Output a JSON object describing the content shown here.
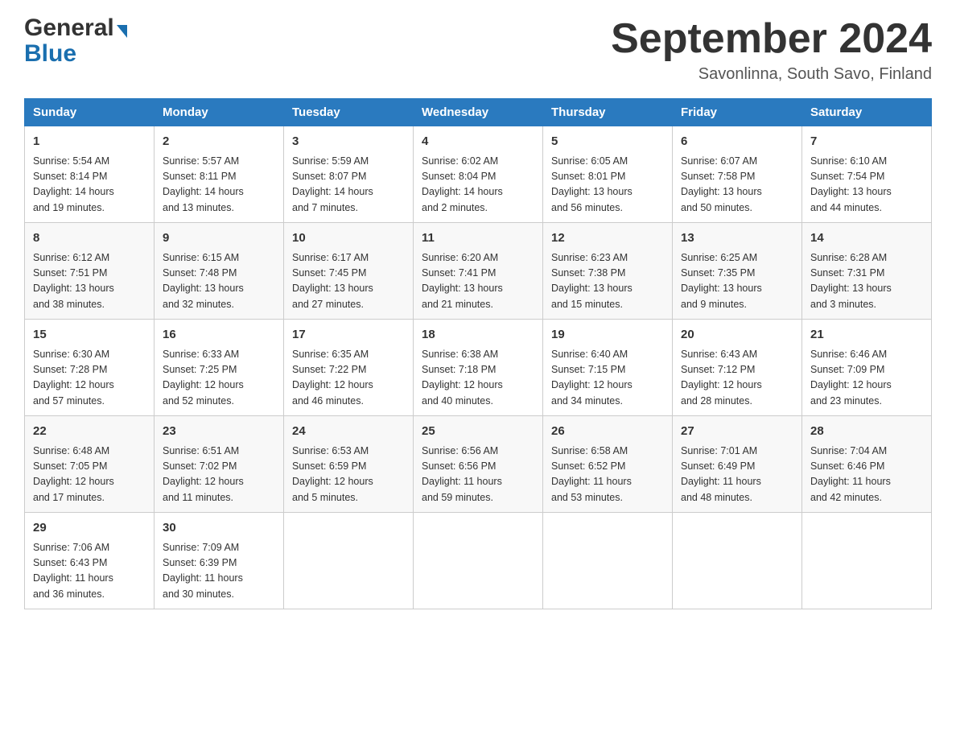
{
  "header": {
    "logo_general": "General",
    "logo_blue": "Blue",
    "title": "September 2024",
    "subtitle": "Savonlinna, South Savo, Finland"
  },
  "days_of_week": [
    "Sunday",
    "Monday",
    "Tuesday",
    "Wednesday",
    "Thursday",
    "Friday",
    "Saturday"
  ],
  "weeks": [
    [
      {
        "day": "1",
        "sunrise": "5:54 AM",
        "sunset": "8:14 PM",
        "daylight": "14 hours and 19 minutes."
      },
      {
        "day": "2",
        "sunrise": "5:57 AM",
        "sunset": "8:11 PM",
        "daylight": "14 hours and 13 minutes."
      },
      {
        "day": "3",
        "sunrise": "5:59 AM",
        "sunset": "8:07 PM",
        "daylight": "14 hours and 7 minutes."
      },
      {
        "day": "4",
        "sunrise": "6:02 AM",
        "sunset": "8:04 PM",
        "daylight": "14 hours and 2 minutes."
      },
      {
        "day": "5",
        "sunrise": "6:05 AM",
        "sunset": "8:01 PM",
        "daylight": "13 hours and 56 minutes."
      },
      {
        "day": "6",
        "sunrise": "6:07 AM",
        "sunset": "7:58 PM",
        "daylight": "13 hours and 50 minutes."
      },
      {
        "day": "7",
        "sunrise": "6:10 AM",
        "sunset": "7:54 PM",
        "daylight": "13 hours and 44 minutes."
      }
    ],
    [
      {
        "day": "8",
        "sunrise": "6:12 AM",
        "sunset": "7:51 PM",
        "daylight": "13 hours and 38 minutes."
      },
      {
        "day": "9",
        "sunrise": "6:15 AM",
        "sunset": "7:48 PM",
        "daylight": "13 hours and 32 minutes."
      },
      {
        "day": "10",
        "sunrise": "6:17 AM",
        "sunset": "7:45 PM",
        "daylight": "13 hours and 27 minutes."
      },
      {
        "day": "11",
        "sunrise": "6:20 AM",
        "sunset": "7:41 PM",
        "daylight": "13 hours and 21 minutes."
      },
      {
        "day": "12",
        "sunrise": "6:23 AM",
        "sunset": "7:38 PM",
        "daylight": "13 hours and 15 minutes."
      },
      {
        "day": "13",
        "sunrise": "6:25 AM",
        "sunset": "7:35 PM",
        "daylight": "13 hours and 9 minutes."
      },
      {
        "day": "14",
        "sunrise": "6:28 AM",
        "sunset": "7:31 PM",
        "daylight": "13 hours and 3 minutes."
      }
    ],
    [
      {
        "day": "15",
        "sunrise": "6:30 AM",
        "sunset": "7:28 PM",
        "daylight": "12 hours and 57 minutes."
      },
      {
        "day": "16",
        "sunrise": "6:33 AM",
        "sunset": "7:25 PM",
        "daylight": "12 hours and 52 minutes."
      },
      {
        "day": "17",
        "sunrise": "6:35 AM",
        "sunset": "7:22 PM",
        "daylight": "12 hours and 46 minutes."
      },
      {
        "day": "18",
        "sunrise": "6:38 AM",
        "sunset": "7:18 PM",
        "daylight": "12 hours and 40 minutes."
      },
      {
        "day": "19",
        "sunrise": "6:40 AM",
        "sunset": "7:15 PM",
        "daylight": "12 hours and 34 minutes."
      },
      {
        "day": "20",
        "sunrise": "6:43 AM",
        "sunset": "7:12 PM",
        "daylight": "12 hours and 28 minutes."
      },
      {
        "day": "21",
        "sunrise": "6:46 AM",
        "sunset": "7:09 PM",
        "daylight": "12 hours and 23 minutes."
      }
    ],
    [
      {
        "day": "22",
        "sunrise": "6:48 AM",
        "sunset": "7:05 PM",
        "daylight": "12 hours and 17 minutes."
      },
      {
        "day": "23",
        "sunrise": "6:51 AM",
        "sunset": "7:02 PM",
        "daylight": "12 hours and 11 minutes."
      },
      {
        "day": "24",
        "sunrise": "6:53 AM",
        "sunset": "6:59 PM",
        "daylight": "12 hours and 5 minutes."
      },
      {
        "day": "25",
        "sunrise": "6:56 AM",
        "sunset": "6:56 PM",
        "daylight": "11 hours and 59 minutes."
      },
      {
        "day": "26",
        "sunrise": "6:58 AM",
        "sunset": "6:52 PM",
        "daylight": "11 hours and 53 minutes."
      },
      {
        "day": "27",
        "sunrise": "7:01 AM",
        "sunset": "6:49 PM",
        "daylight": "11 hours and 48 minutes."
      },
      {
        "day": "28",
        "sunrise": "7:04 AM",
        "sunset": "6:46 PM",
        "daylight": "11 hours and 42 minutes."
      }
    ],
    [
      {
        "day": "29",
        "sunrise": "7:06 AM",
        "sunset": "6:43 PM",
        "daylight": "11 hours and 36 minutes."
      },
      {
        "day": "30",
        "sunrise": "7:09 AM",
        "sunset": "6:39 PM",
        "daylight": "11 hours and 30 minutes."
      },
      null,
      null,
      null,
      null,
      null
    ]
  ],
  "labels": {
    "sunrise": "Sunrise:",
    "sunset": "Sunset:",
    "daylight": "Daylight:"
  }
}
